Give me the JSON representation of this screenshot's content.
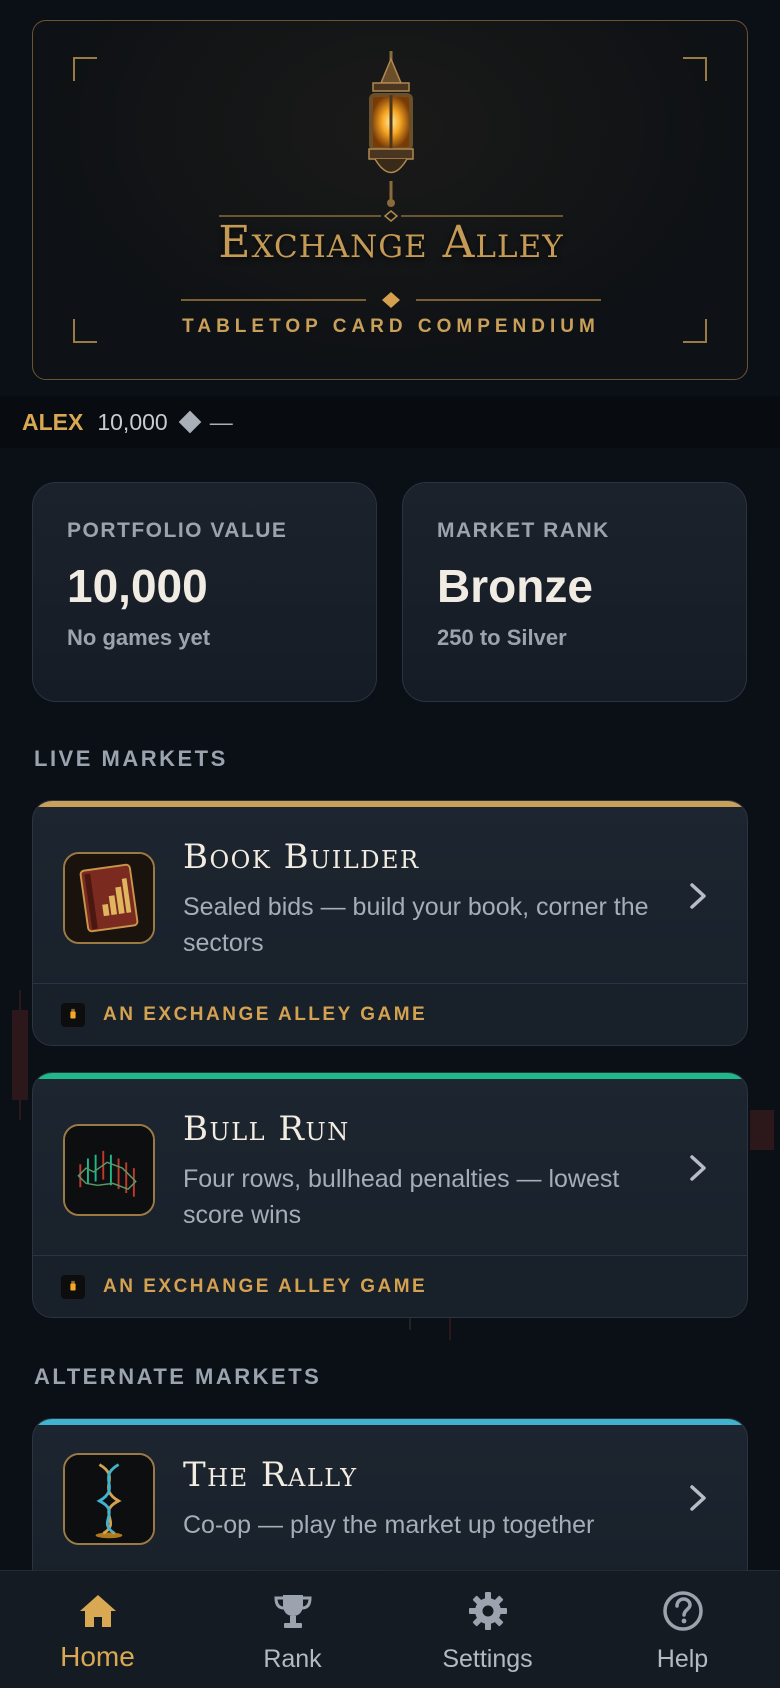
{
  "hero": {
    "title": "Exchange Alley",
    "subtitle": "TABLETOP CARD COMPENDIUM"
  },
  "user": {
    "name": "ALEX",
    "balance": "10,000",
    "change": "—"
  },
  "stats": [
    {
      "label": "PORTFOLIO VALUE",
      "value": "10,000",
      "sub": "No games yet"
    },
    {
      "label": "MARKET RANK",
      "value": "Bronze",
      "sub": "250 to Silver"
    }
  ],
  "sections": {
    "live": "LIVE MARKETS",
    "alternate": "ALTERNATE MARKETS"
  },
  "games": [
    {
      "name": "Book Builder",
      "desc": "Sealed bids — build your book, corner the sectors",
      "footer": "AN EXCHANGE ALLEY GAME",
      "accent": "#c9a05a",
      "icon": "book-icon"
    },
    {
      "name": "Bull Run",
      "desc": "Four rows, bullhead penalties — lowest score wins",
      "footer": "AN EXCHANGE ALLEY GAME",
      "accent": "#1fb88a",
      "icon": "bull-icon"
    },
    {
      "name": "The Rally",
      "desc": "Co-op — play the market up together",
      "accent": "#3fb3cf",
      "icon": "helix-icon"
    }
  ],
  "nav": [
    {
      "label": "Home",
      "icon": "home-icon",
      "active": true
    },
    {
      "label": "Rank",
      "icon": "trophy-icon",
      "active": false
    },
    {
      "label": "Settings",
      "icon": "gear-icon",
      "active": false
    },
    {
      "label": "Help",
      "icon": "help-icon",
      "active": false
    }
  ],
  "colors": {
    "background": "#0b1017",
    "gold": "#d8a852",
    "card": "#1b222c"
  }
}
